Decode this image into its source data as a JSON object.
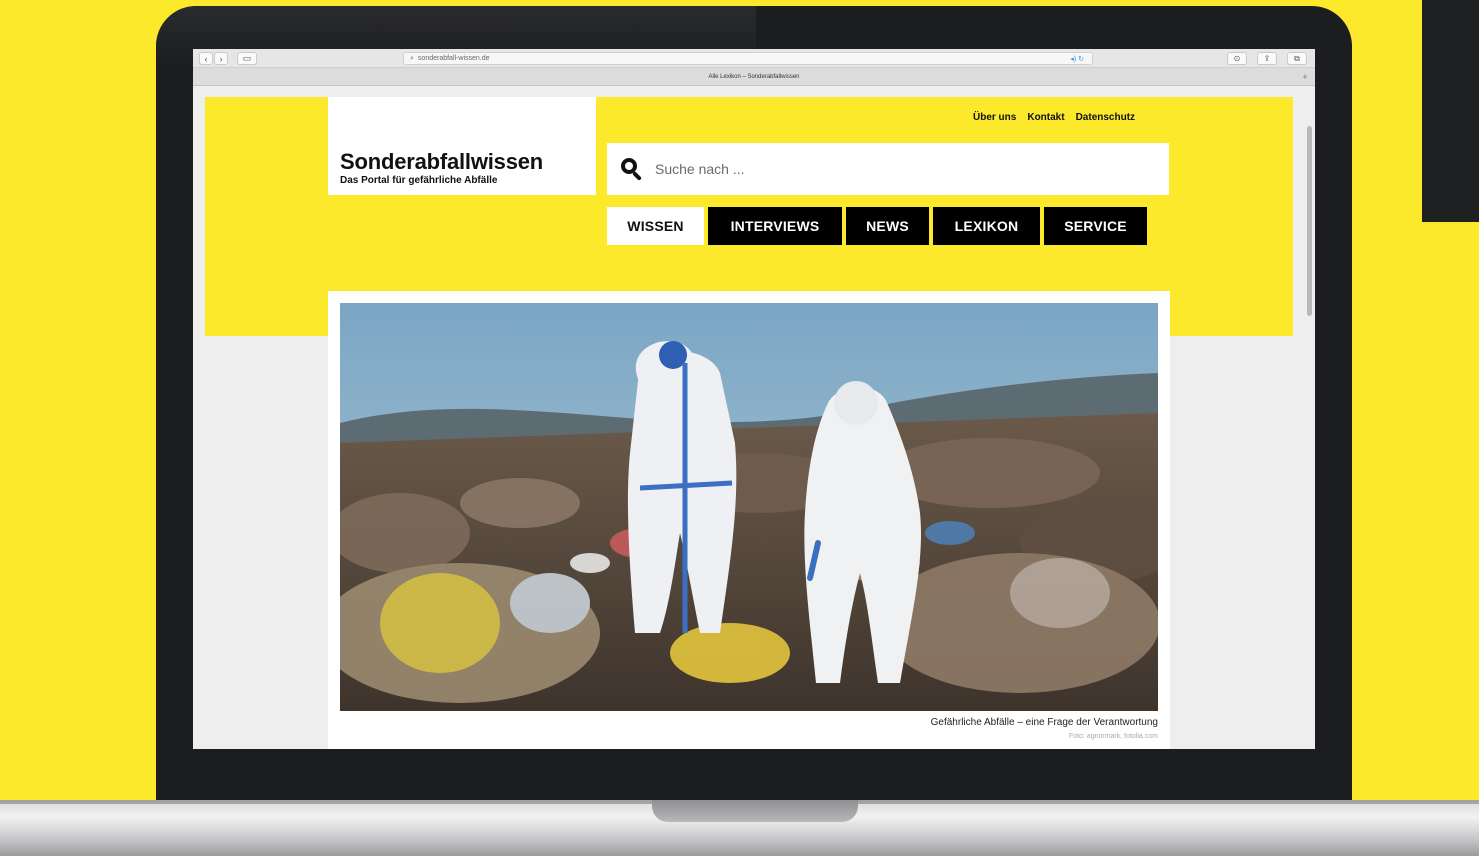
{
  "browser": {
    "url": "sonderabfall-wissen.de",
    "tab_title": "Alle Lexikon – Sonderabfallwissen"
  },
  "site": {
    "logo_title": "Sonderabfallwissen",
    "logo_subtitle": "Das Portal für gefährliche Abfälle",
    "top_links": [
      "Über uns",
      "Kontakt",
      "Datenschutz"
    ],
    "search_placeholder": "Suche nach ...",
    "nav": [
      {
        "label": "WISSEN",
        "active": true
      },
      {
        "label": "INTERVIEWS",
        "active": false
      },
      {
        "label": "NEWS",
        "active": false
      },
      {
        "label": "LEXIKON",
        "active": false
      },
      {
        "label": "SERVICE",
        "active": false
      }
    ],
    "hero_caption": "Gefährliche Abfälle – eine Frage der Verantwortung",
    "hero_credit": "Foto: agnormark, fotolia.com"
  },
  "colors": {
    "brand_yellow": "#fde92b",
    "nav_black": "#000000"
  }
}
